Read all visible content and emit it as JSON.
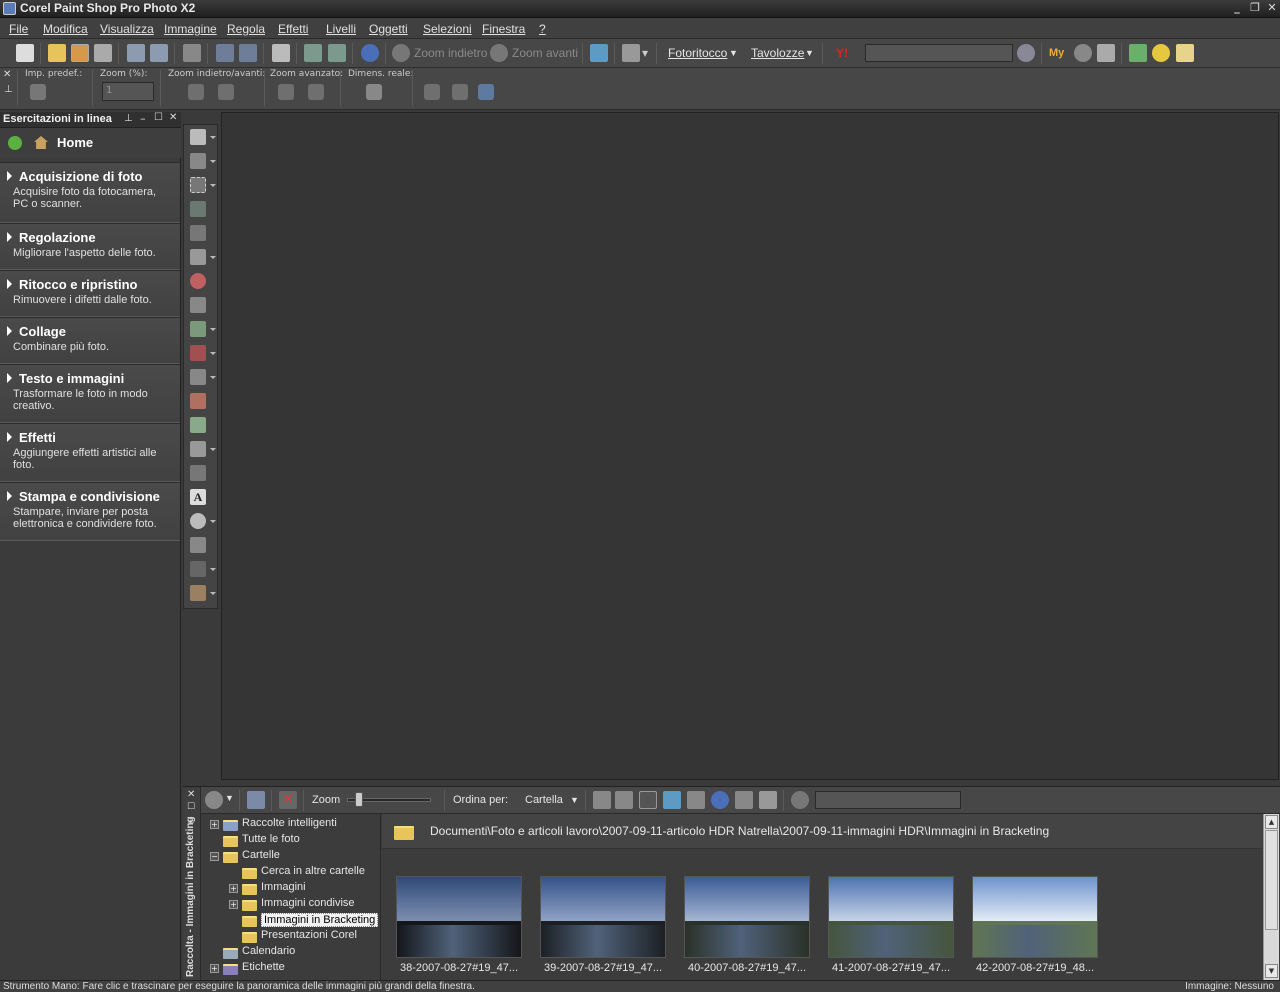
{
  "app": {
    "title": "Corel Paint Shop Pro Photo X2"
  },
  "menu": [
    "File",
    "Modifica",
    "Visualizza",
    "Immagine",
    "Regola",
    "Effetti",
    "Livelli",
    "Oggetti",
    "Selezioni",
    "Finestra",
    "?"
  ],
  "toolbar": {
    "zoom_back": "Zoom indietro",
    "zoom_forward": "Zoom avanti",
    "fotoritocco": "Fotoritocco",
    "tavolozze": "Tavolozze",
    "my_label": "My"
  },
  "options_bar": {
    "preset_label": "Imp. predef.:",
    "zoom_pct_label": "Zoom (%):",
    "zoom_value": "1",
    "zoom_inout_label": "Zoom indietro/avanti:",
    "zoom_adv_label": "Zoom avanzato:",
    "actual_size_label": "Dimens. reale:"
  },
  "learning_center": {
    "header": "Esercitazioni in linea",
    "home": "Home",
    "sections": [
      {
        "title": "Acquisizione di foto",
        "desc": "Acquisire foto da fotocamera, PC o scanner."
      },
      {
        "title": "Regolazione",
        "desc": "Migliorare l'aspetto delle foto."
      },
      {
        "title": "Ritocco e ripristino",
        "desc": "Rimuovere i difetti dalle foto."
      },
      {
        "title": "Collage",
        "desc": "Combinare più foto."
      },
      {
        "title": "Testo e immagini",
        "desc": "Trasformare le foto in modo creativo."
      },
      {
        "title": "Effetti",
        "desc": "Aggiungere effetti artistici alle foto."
      },
      {
        "title": "Stampa e condivisione",
        "desc": "Stampare, inviare per posta elettronica e condividere foto."
      }
    ]
  },
  "organizer": {
    "side_title": "Raccolta - Immagini in Bracketing",
    "zoom_label": "Zoom",
    "sort_label": "Ordina per:",
    "sort_value": "Cartella",
    "zoom_level": 0.1,
    "path": "Documenti\\Foto e articoli lavoro\\2007-09-11-articolo HDR Natrella\\2007-09-11-immagini HDR\\Immagini in Bracketing",
    "tree": [
      {
        "label": "Raccolte intelligenti",
        "expander": "+"
      },
      {
        "label": "Tutte le foto",
        "expander": ""
      },
      {
        "label": "Cartelle",
        "expander": "−"
      },
      {
        "label": "Cerca in altre cartelle",
        "expander": ""
      },
      {
        "label": "Immagini",
        "expander": "+"
      },
      {
        "label": "Immagini condivise",
        "expander": "+"
      },
      {
        "label": "Immagini in Bracketing",
        "expander": ""
      },
      {
        "label": "Presentazioni Corel",
        "expander": ""
      },
      {
        "label": "Calendario",
        "expander": ""
      },
      {
        "label": "Etichette",
        "expander": "+"
      }
    ],
    "thumbnails": [
      {
        "caption": "38-2007-08-27#19_47..."
      },
      {
        "caption": "39-2007-08-27#19_47..."
      },
      {
        "caption": "40-2007-08-27#19_47..."
      },
      {
        "caption": "41-2007-08-27#19_47..."
      },
      {
        "caption": "42-2007-08-27#19_48..."
      }
    ]
  },
  "status": {
    "left": "Strumento Mano: Fare clic e trascinare per eseguire la panoramica delle immagini più grandi della finestra.",
    "right": "Immagine: Nessuno"
  }
}
